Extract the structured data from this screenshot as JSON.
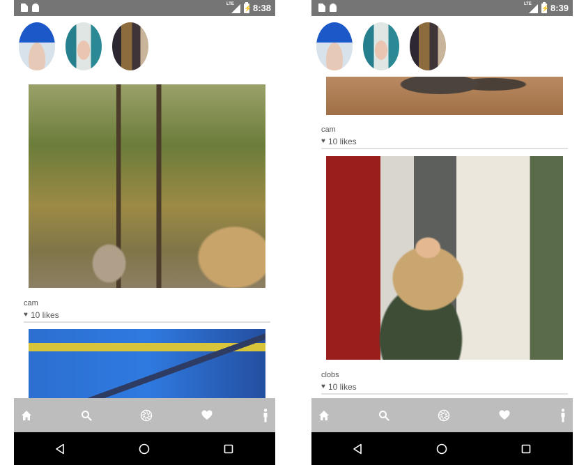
{
  "screens": [
    {
      "status_bar": {
        "network": "LTE",
        "time": "8:38"
      },
      "stories": [
        {
          "name": "story-avatar-1"
        },
        {
          "name": "story-avatar-2"
        },
        {
          "name": "story-avatar-3"
        }
      ],
      "posts": [
        {
          "username": "cam",
          "likes": "10 likes"
        }
      ]
    },
    {
      "status_bar": {
        "network": "LTE",
        "time": "8:39"
      },
      "stories": [
        {
          "name": "story-avatar-1"
        },
        {
          "name": "story-avatar-2"
        },
        {
          "name": "story-avatar-3"
        }
      ],
      "posts": [
        {
          "username": "cam",
          "likes": "10 likes"
        },
        {
          "username": "clobs",
          "likes": "10 likes"
        }
      ]
    }
  ],
  "bottom_nav": {
    "icons": [
      "home-icon",
      "search-icon",
      "camera-aperture-icon",
      "heart-icon",
      "profile-icon"
    ],
    "background": "#bdbdbd",
    "icon_color": "#ffffff"
  },
  "system_nav": {
    "icons": [
      "back-icon",
      "home-circle-icon",
      "recents-icon"
    ]
  },
  "colors": {
    "status_bar": "#757575",
    "feed_background": "#ffffff",
    "caption_text": "#555555",
    "divider": "#e0e0e0"
  }
}
